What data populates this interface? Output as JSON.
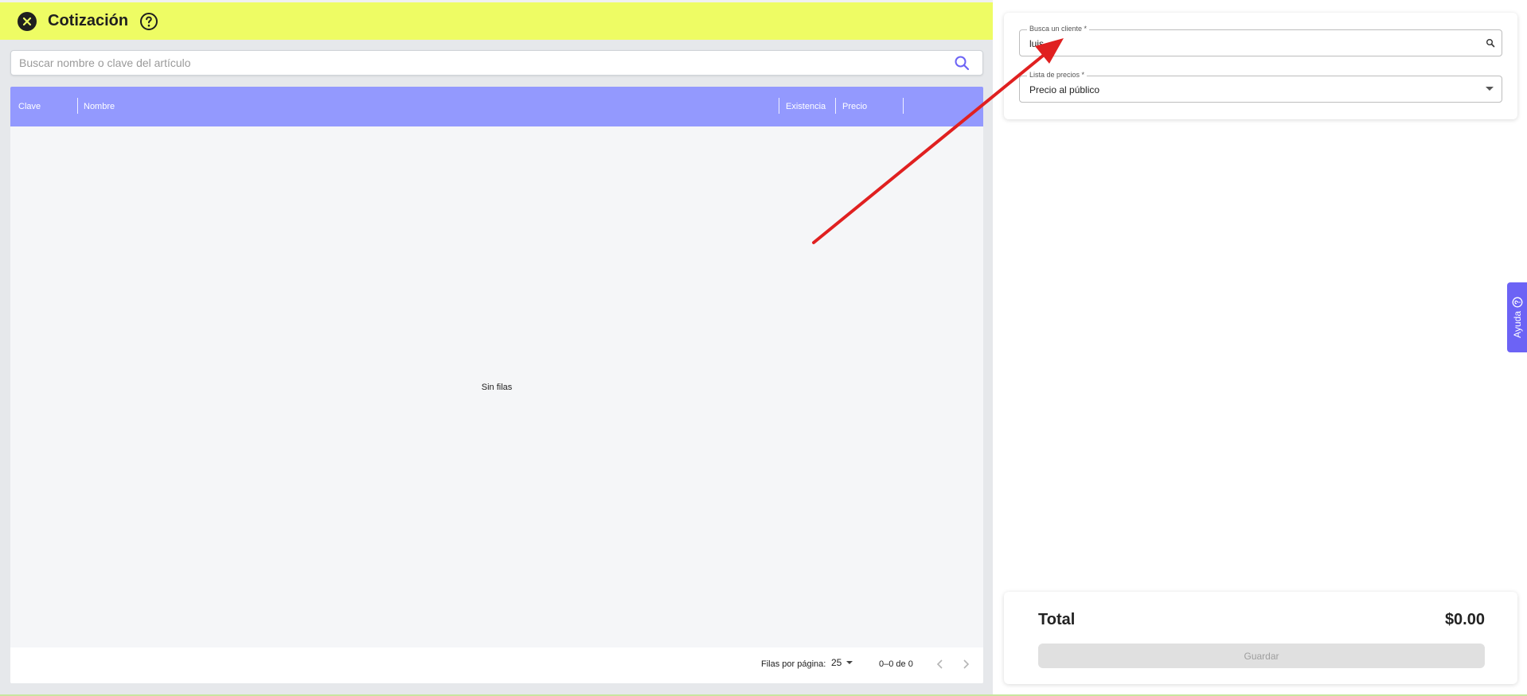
{
  "header": {
    "title": "Cotización"
  },
  "article_search": {
    "placeholder": "Buscar nombre o clave del artículo"
  },
  "table": {
    "columns": [
      "Clave",
      "Nombre",
      "Existencia",
      "Precio"
    ],
    "empty_text": "Sin filas",
    "rows_per_page_label": "Filas por página:",
    "rows_per_page_value": "25",
    "range_text": "0–0 de 0"
  },
  "client_form": {
    "client_label": "Busca un cliente *",
    "client_value": "luis",
    "price_list_label": "Lista de precios *",
    "price_list_value": "Precio al público"
  },
  "summary": {
    "total_label": "Total",
    "total_value": "$0.00",
    "save_label": "Guardar"
  },
  "help_tab": {
    "label": "Ayuda"
  },
  "colors": {
    "header_bg": "#eefc64",
    "table_header_bg": "#9399fe",
    "accent": "#6c63f5",
    "annotation_arrow": "#e02020"
  }
}
